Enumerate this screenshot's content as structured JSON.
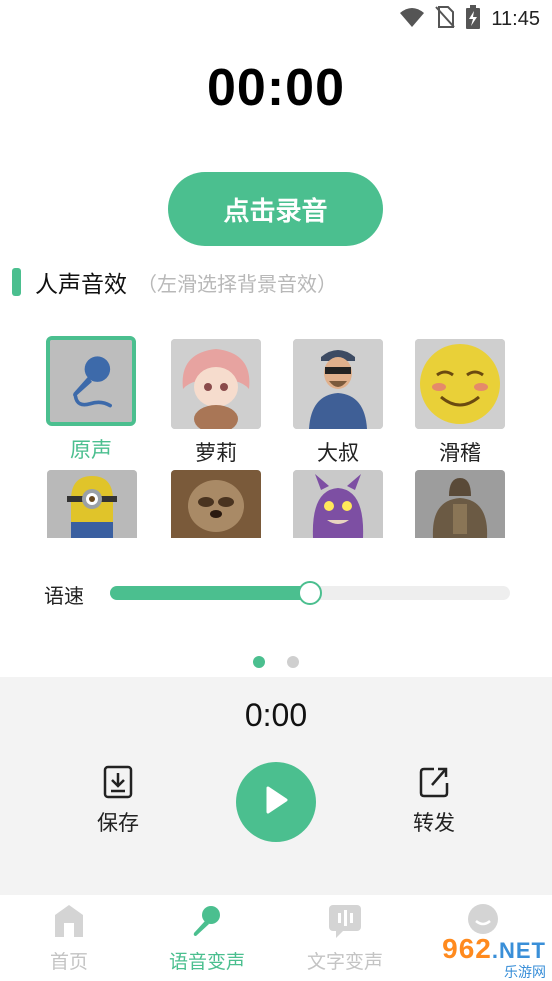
{
  "status_bar": {
    "time": "11:45",
    "icons": [
      "wifi-icon",
      "no-sim-icon",
      "battery-charging-icon"
    ]
  },
  "timer": "00:00",
  "record_button": "点击录音",
  "section": {
    "title": "人声音效",
    "hint": "（左滑选择背景音效）"
  },
  "voices": [
    {
      "label": "原声",
      "icon": "microphone-icon",
      "selected": true
    },
    {
      "label": "萝莉",
      "icon": "anime-girl-avatar"
    },
    {
      "label": "大叔",
      "icon": "uncle-avatar"
    },
    {
      "label": "滑稽",
      "icon": "smiley-face-avatar"
    },
    {
      "label": "",
      "icon": "minion-avatar"
    },
    {
      "label": "",
      "icon": "sloth-avatar"
    },
    {
      "label": "",
      "icon": "monster-avatar"
    },
    {
      "label": "",
      "icon": "armor-knight-avatar"
    }
  ],
  "speed": {
    "label": "语速",
    "value": 0.5
  },
  "pager": {
    "count": 2,
    "active": 0
  },
  "player": {
    "time": "0:00",
    "save_label": "保存",
    "share_label": "转发"
  },
  "nav": [
    {
      "label": "首页",
      "icon": "home-icon"
    },
    {
      "label": "语音变声",
      "icon": "microphone-icon",
      "active": true
    },
    {
      "label": "文字变声",
      "icon": "chat-voice-icon"
    },
    {
      "label": "",
      "icon": "profile-icon"
    }
  ],
  "watermark": {
    "main": "962",
    "net": ".NET",
    "sub": "乐游网"
  },
  "colors": {
    "accent": "#4bbf8f",
    "panel": "#f3f3f3"
  }
}
